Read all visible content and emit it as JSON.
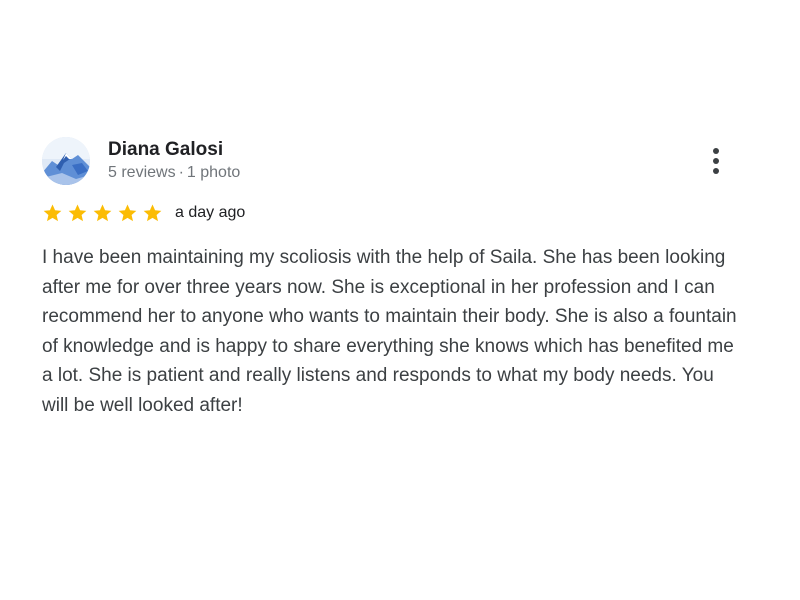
{
  "review": {
    "reviewer_name": "Diana Galosi",
    "reviews_count": "5 reviews",
    "separator": "·",
    "photos_count": "1 photo",
    "rating": 5,
    "max_rating": 5,
    "date": "a day ago",
    "text": "I have been maintaining my scoliosis with the help of Saila. She has been looking after me for over three years now. She is exceptional in her profession and I can recommend her to anyone who wants to maintain their body. She is also a fountain of knowledge and is happy to share everything she knows which has benefited me a lot. She is patient and really listens and responds to what my body needs. You will be well looked after!"
  },
  "icons": {
    "avatar": "mountain-landscape-avatar",
    "more": "more-vert-icon",
    "star": "star-icon"
  },
  "colors": {
    "star": "#fbbc04",
    "name": "#202124",
    "meta": "#70757a",
    "body": "#3c4043"
  }
}
